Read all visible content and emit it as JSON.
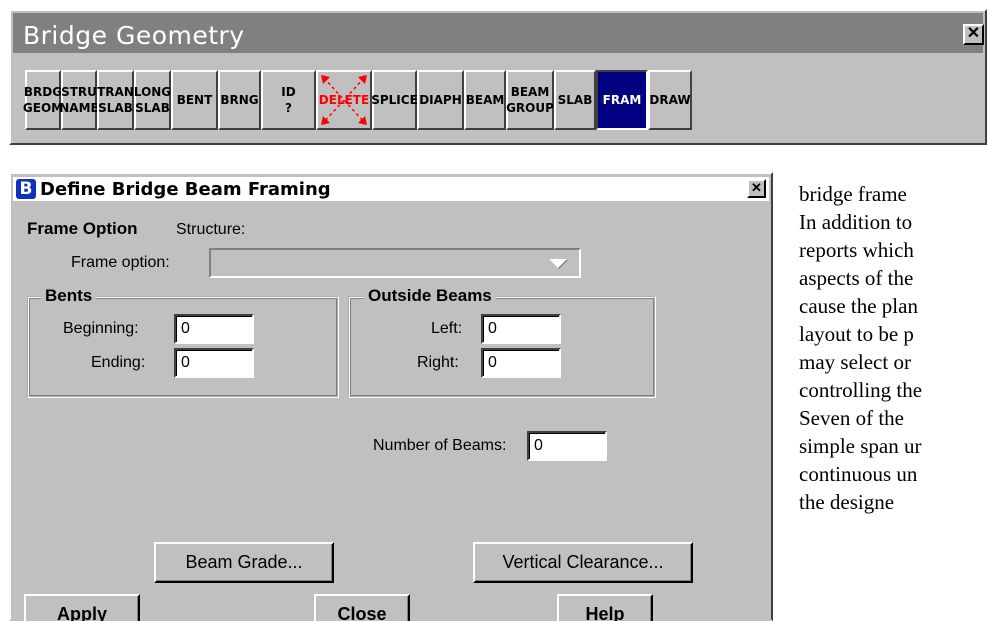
{
  "toolbar": {
    "title": "Bridge Geometry",
    "close_label": "✕",
    "buttons": [
      {
        "label": "BRDG\nGEOM",
        "name": "brdg-geom-button",
        "active": false
      },
      {
        "label": "STRU\nNAME",
        "name": "stru-name-button",
        "active": false
      },
      {
        "label": "TRAN\nSLAB",
        "name": "tran-slab-button",
        "active": false
      },
      {
        "label": "LONG\nSLAB",
        "name": "long-slab-button",
        "active": false
      },
      {
        "label": "BENT",
        "name": "bent-button",
        "active": false
      },
      {
        "label": "BRNG",
        "name": "brng-button",
        "active": false
      },
      {
        "label": "ID\n?",
        "name": "id-button",
        "active": false
      },
      {
        "label": "DELETE",
        "name": "delete-button",
        "active": false
      },
      {
        "label": "SPLICE",
        "name": "splice-button",
        "active": false
      },
      {
        "label": "DIAPH",
        "name": "diaph-button",
        "active": false
      },
      {
        "label": "BEAM",
        "name": "beam-button",
        "active": false
      },
      {
        "label": "BEAM\nGROUP",
        "name": "beam-group-button",
        "active": false
      },
      {
        "label": "SLAB",
        "name": "slab-button",
        "active": false
      },
      {
        "label": "FRAM",
        "name": "fram-button",
        "active": true
      },
      {
        "label": "DRAW",
        "name": "draw-button",
        "active": false
      }
    ],
    "colors": {
      "title_bar": "#808080",
      "active_button": "#000080",
      "delete_icon": "#ff0000"
    }
  },
  "dialog": {
    "logo": "B",
    "title": "Define Bridge Beam Framing",
    "close_label": "✕",
    "frame_option_heading": "Frame Option",
    "structure_label": "Structure:",
    "frame_option_label": "Frame option:",
    "frame_option_value": "",
    "bents": {
      "title": "Bents",
      "beginning_label": "Beginning:",
      "beginning_value": "0",
      "ending_label": "Ending:",
      "ending_value": "0"
    },
    "outside_beams": {
      "title": "Outside Beams",
      "left_label": "Left:",
      "left_value": "0",
      "right_label": "Right:",
      "right_value": "0"
    },
    "number_of_beams_label": "Number of Beams:",
    "number_of_beams_value": "0",
    "beam_grade_button": "Beam Grade...",
    "vertical_clearance_button": "Vertical Clearance...",
    "apply_button": "Apply",
    "close_button": "Close",
    "help_button": "Help"
  },
  "document_text": [
    "bridge frame",
    "In addition to",
    "reports which",
    "aspects of the",
    "cause the plan",
    "layout to be p",
    "may select or",
    "controlling the",
    "Seven of the",
    "simple span ur",
    "continuous un",
    "the    designe"
  ]
}
